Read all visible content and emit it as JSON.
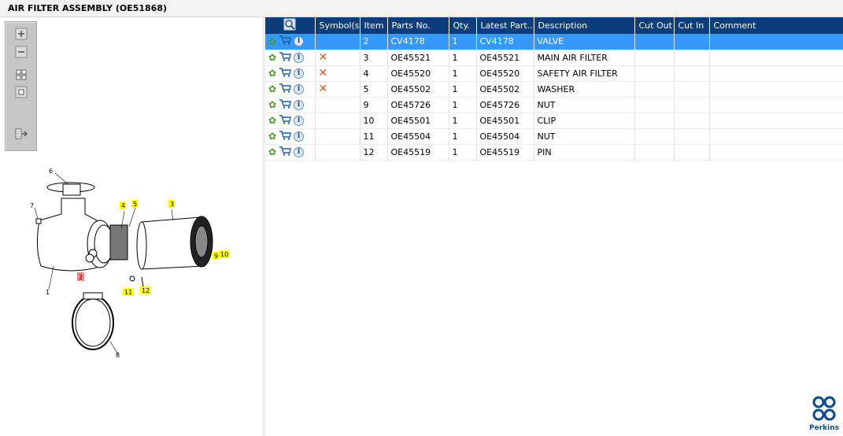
{
  "window": {
    "title": "AIR FILTER ASSEMBLY (OE51868)"
  },
  "toolbar": {
    "icons": [
      "zoom-in-icon",
      "zoom-out-icon",
      "fit-all-icon",
      "fit-page-icon",
      "export-icon"
    ]
  },
  "diagram": {
    "callouts": [
      "1",
      "2",
      "3",
      "4",
      "5",
      "6",
      "7",
      "8",
      "9",
      "10",
      "11",
      "12"
    ],
    "highlighted_callout": "2",
    "highlight_color": "#f08c8c",
    "marker_color": "#ffff00"
  },
  "grid": {
    "headers": [
      "",
      "Symbol(s)",
      "Item",
      "Parts No.",
      "Qty.",
      "Latest Part...",
      "Description",
      "Cut Out",
      "Cut In",
      "Comment"
    ],
    "rows": [
      {
        "symbol": "",
        "item": "2",
        "part": "CV4178",
        "qty": "1",
        "latest": "CV4178",
        "description": "VALVE",
        "cut_out": "",
        "cut_in": "",
        "comment": "",
        "selected": true
      },
      {
        "symbol": "x",
        "item": "3",
        "part": "OE45521",
        "qty": "1",
        "latest": "OE45521",
        "description": "MAIN AIR FILTER",
        "cut_out": "",
        "cut_in": "",
        "comment": ""
      },
      {
        "symbol": "x",
        "item": "4",
        "part": "OE45520",
        "qty": "1",
        "latest": "OE45520",
        "description": "SAFETY AIR FILTER",
        "cut_out": "",
        "cut_in": "",
        "comment": ""
      },
      {
        "symbol": "x",
        "item": "5",
        "part": "OE45502",
        "qty": "1",
        "latest": "OE45502",
        "description": "WASHER",
        "cut_out": "",
        "cut_in": "",
        "comment": ""
      },
      {
        "symbol": "",
        "item": "9",
        "part": "OE45726",
        "qty": "1",
        "latest": "OE45726",
        "description": "NUT",
        "cut_out": "",
        "cut_in": "",
        "comment": ""
      },
      {
        "symbol": "",
        "item": "10",
        "part": "OE45501",
        "qty": "1",
        "latest": "OE45501",
        "description": "CLIP",
        "cut_out": "",
        "cut_in": "",
        "comment": ""
      },
      {
        "symbol": "",
        "item": "11",
        "part": "OE45504",
        "qty": "1",
        "latest": "OE45504",
        "description": "NUT",
        "cut_out": "",
        "cut_in": "",
        "comment": ""
      },
      {
        "symbol": "",
        "item": "12",
        "part": "OE45519",
        "qty": "1",
        "latest": "OE45519",
        "description": "PIN",
        "cut_out": "",
        "cut_in": "",
        "comment": ""
      }
    ]
  },
  "colors": {
    "header_bg": "#0b3d7a",
    "selection": "#3399ff",
    "remove_mark": "#e8551a"
  },
  "logo": {
    "text": "Perkins"
  }
}
